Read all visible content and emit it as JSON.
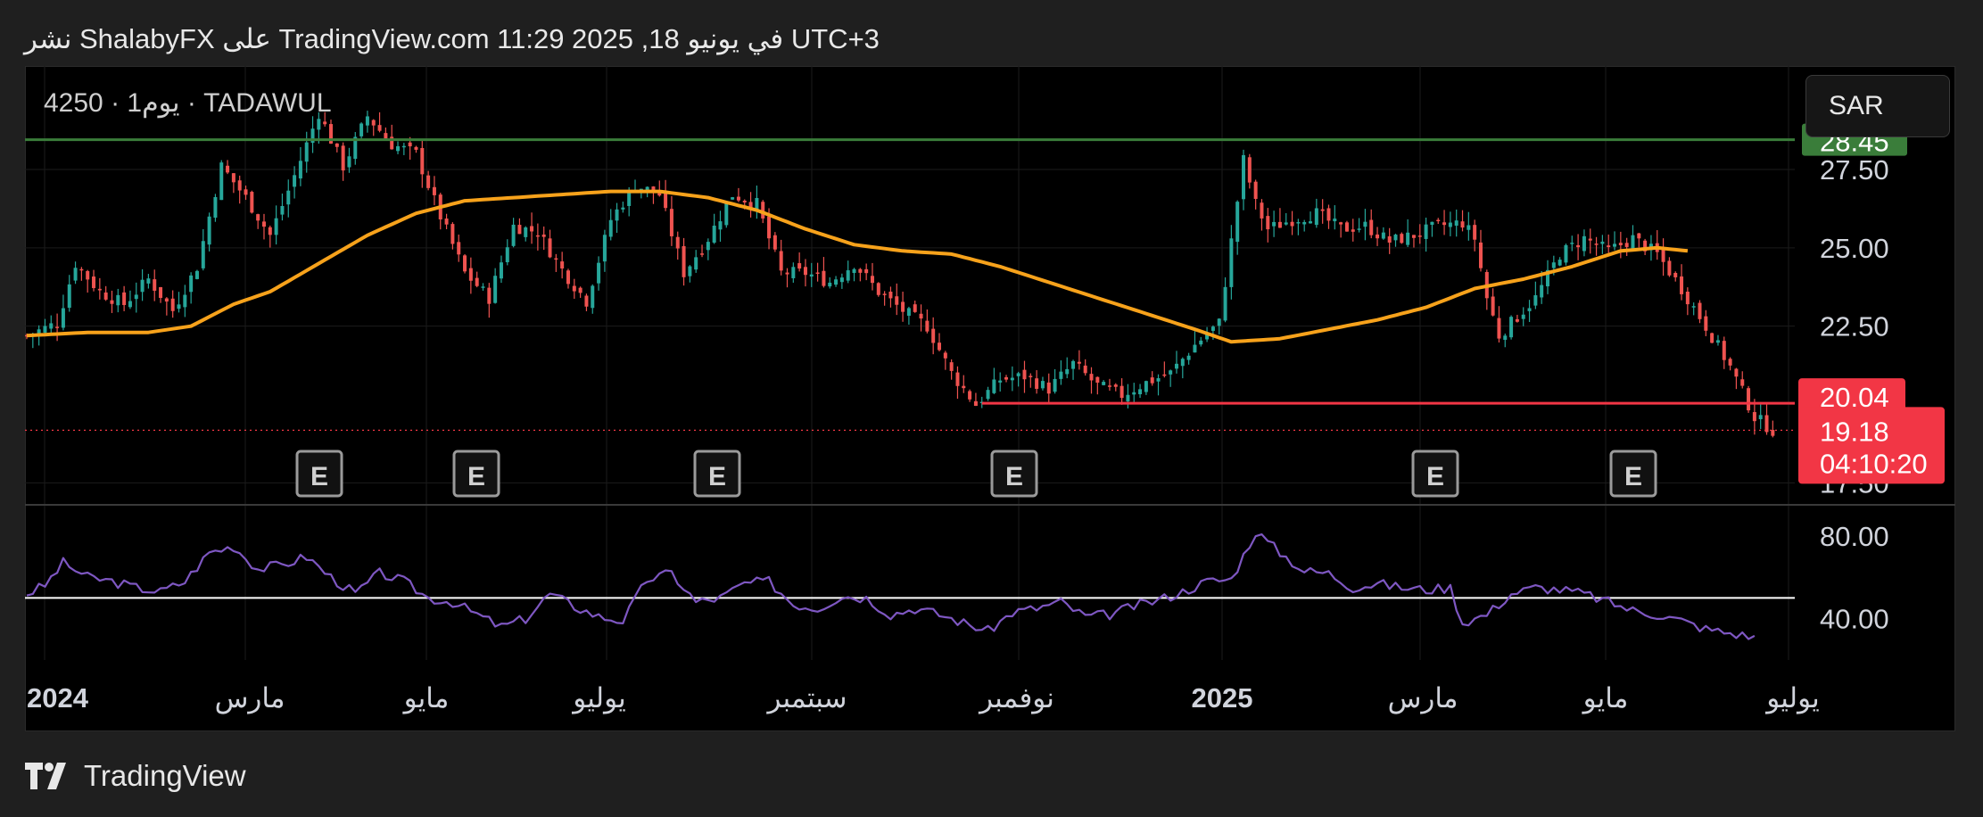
{
  "header": {
    "text": "نشر ShalabyFX على TradingView.com 11:29 2025 ,18 في يونيو UTC+3"
  },
  "symbol": {
    "label": "4250 · 1يوم · TADAWUL"
  },
  "currency": {
    "label": "SAR"
  },
  "footer": {
    "brand": "TradingView"
  },
  "colors": {
    "up": "#26a69a",
    "down": "#ef5350",
    "ma": "#f7a21b",
    "rsi": "#7e57c2",
    "resistance": "#3a7d3a",
    "support": "#f23645",
    "last": "#f23645"
  },
  "chart_data": {
    "type": "candlestick",
    "price_axis": {
      "ticks": [
        {
          "label": "27.50",
          "value": 27.5
        },
        {
          "label": "25.00",
          "value": 25.0
        },
        {
          "label": "22.50",
          "value": 22.5
        },
        {
          "label": "17.50",
          "value": 17.5
        }
      ],
      "range": [
        16.8,
        30.8
      ]
    },
    "rsi_axis": {
      "ticks": [
        {
          "label": "80.00",
          "value": 80
        },
        {
          "label": "40.00",
          "value": 40
        }
      ],
      "range": [
        20,
        95
      ]
    },
    "time_axis": [
      {
        "label": "2024",
        "bold": true
      },
      {
        "label": "مارس"
      },
      {
        "label": "مايو"
      },
      {
        "label": "يوليو"
      },
      {
        "label": "سبتمبر"
      },
      {
        "label": "نوفمبر"
      },
      {
        "label": "2025",
        "bold": true
      },
      {
        "label": "مارس"
      },
      {
        "label": "مايو"
      },
      {
        "label": "يوليو"
      }
    ],
    "resistance": {
      "value": 28.45,
      "label": "28.45"
    },
    "support": {
      "value": 20.04,
      "label": "20.04"
    },
    "last_price": {
      "value": 19.18,
      "label": "19.18",
      "countdown": "04:10:20"
    },
    "earnings_marker": "E",
    "earnings_count": 6,
    "close_anchors": [
      [
        0,
        22.2
      ],
      [
        5,
        22.6
      ],
      [
        8,
        24.5
      ],
      [
        12,
        23.6
      ],
      [
        16,
        23.2
      ],
      [
        20,
        24.0
      ],
      [
        24,
        23.0
      ],
      [
        28,
        24.4
      ],
      [
        32,
        27.6
      ],
      [
        36,
        26.6
      ],
      [
        40,
        25.4
      ],
      [
        44,
        27.3
      ],
      [
        48,
        29.3
      ],
      [
        52,
        27.6
      ],
      [
        56,
        29.2
      ],
      [
        60,
        28.3
      ],
      [
        64,
        28.0
      ],
      [
        68,
        26.0
      ],
      [
        72,
        24.2
      ],
      [
        76,
        23.4
      ],
      [
        80,
        25.7
      ],
      [
        84,
        25.5
      ],
      [
        88,
        24.3
      ],
      [
        92,
        23.3
      ],
      [
        96,
        25.9
      ],
      [
        100,
        27.0
      ],
      [
        104,
        26.7
      ],
      [
        108,
        24.2
      ],
      [
        112,
        25.3
      ],
      [
        116,
        26.7
      ],
      [
        120,
        26.4
      ],
      [
        124,
        24.2
      ],
      [
        128,
        24.2
      ],
      [
        132,
        23.9
      ],
      [
        136,
        24.5
      ],
      [
        140,
        23.6
      ],
      [
        144,
        23.0
      ],
      [
        148,
        22.5
      ],
      [
        152,
        21.0
      ],
      [
        156,
        20.0
      ],
      [
        160,
        20.8
      ],
      [
        164,
        20.9
      ],
      [
        168,
        20.5
      ],
      [
        172,
        21.3
      ],
      [
        176,
        20.6
      ],
      [
        180,
        20.3
      ],
      [
        184,
        20.7
      ],
      [
        188,
        21.0
      ],
      [
        192,
        21.9
      ],
      [
        196,
        22.6
      ],
      [
        200,
        27.8
      ],
      [
        202,
        26.4
      ],
      [
        204,
        25.6
      ],
      [
        208,
        25.9
      ],
      [
        212,
        26.1
      ],
      [
        216,
        25.6
      ],
      [
        220,
        25.7
      ],
      [
        224,
        25.2
      ],
      [
        228,
        25.4
      ],
      [
        232,
        25.7
      ],
      [
        236,
        25.8
      ],
      [
        238,
        25.3
      ],
      [
        240,
        23.4
      ],
      [
        242,
        22.2
      ],
      [
        244,
        22.6
      ],
      [
        248,
        23.4
      ],
      [
        252,
        24.8
      ],
      [
        256,
        25.3
      ],
      [
        260,
        24.9
      ],
      [
        264,
        25.3
      ],
      [
        268,
        24.8
      ],
      [
        272,
        23.7
      ],
      [
        276,
        22.5
      ],
      [
        280,
        21.2
      ],
      [
        284,
        19.6
      ],
      [
        287,
        19.18
      ]
    ],
    "ma_anchors": [
      [
        0,
        22.2
      ],
      [
        10,
        22.3
      ],
      [
        20,
        22.3
      ],
      [
        27,
        22.5
      ],
      [
        34,
        23.2
      ],
      [
        40,
        23.6
      ],
      [
        48,
        24.5
      ],
      [
        56,
        25.4
      ],
      [
        64,
        26.1
      ],
      [
        72,
        26.5
      ],
      [
        80,
        26.6
      ],
      [
        88,
        26.7
      ],
      [
        96,
        26.8
      ],
      [
        104,
        26.8
      ],
      [
        112,
        26.6
      ],
      [
        120,
        26.2
      ],
      [
        128,
        25.6
      ],
      [
        136,
        25.1
      ],
      [
        144,
        24.9
      ],
      [
        152,
        24.8
      ],
      [
        160,
        24.4
      ],
      [
        168,
        23.9
      ],
      [
        176,
        23.4
      ],
      [
        184,
        22.9
      ],
      [
        192,
        22.4
      ],
      [
        198,
        22.0
      ],
      [
        206,
        22.1
      ],
      [
        214,
        22.4
      ],
      [
        222,
        22.7
      ],
      [
        230,
        23.1
      ],
      [
        238,
        23.7
      ],
      [
        246,
        24.0
      ],
      [
        254,
        24.4
      ],
      [
        262,
        24.9
      ],
      [
        268,
        25.0
      ],
      [
        273,
        24.9
      ]
    ],
    "rsi_anchors": [
      [
        0,
        52
      ],
      [
        3,
        56
      ],
      [
        6,
        67
      ],
      [
        10,
        60
      ],
      [
        14,
        58
      ],
      [
        18,
        55
      ],
      [
        22,
        53
      ],
      [
        26,
        58
      ],
      [
        30,
        72
      ],
      [
        34,
        75
      ],
      [
        38,
        64
      ],
      [
        42,
        66
      ],
      [
        46,
        70
      ],
      [
        50,
        60
      ],
      [
        54,
        52
      ],
      [
        58,
        62
      ],
      [
        62,
        58
      ],
      [
        66,
        50
      ],
      [
        70,
        48
      ],
      [
        74,
        42
      ],
      [
        78,
        36
      ],
      [
        82,
        40
      ],
      [
        86,
        52
      ],
      [
        90,
        46
      ],
      [
        94,
        41
      ],
      [
        98,
        39
      ],
      [
        102,
        59
      ],
      [
        106,
        62
      ],
      [
        110,
        48
      ],
      [
        114,
        50
      ],
      [
        118,
        57
      ],
      [
        122,
        58
      ],
      [
        126,
        47
      ],
      [
        130,
        45
      ],
      [
        134,
        51
      ],
      [
        138,
        50
      ],
      [
        142,
        42
      ],
      [
        146,
        45
      ],
      [
        150,
        42
      ],
      [
        154,
        38
      ],
      [
        158,
        34
      ],
      [
        162,
        43
      ],
      [
        166,
        45
      ],
      [
        170,
        48
      ],
      [
        174,
        41
      ],
      [
        178,
        42
      ],
      [
        182,
        46
      ],
      [
        186,
        49
      ],
      [
        190,
        53
      ],
      [
        194,
        58
      ],
      [
        198,
        59
      ],
      [
        202,
        82
      ],
      [
        206,
        72
      ],
      [
        210,
        63
      ],
      [
        214,
        62
      ],
      [
        218,
        55
      ],
      [
        222,
        57
      ],
      [
        226,
        55
      ],
      [
        230,
        54
      ],
      [
        234,
        55
      ],
      [
        236,
        38
      ],
      [
        240,
        42
      ],
      [
        244,
        52
      ],
      [
        248,
        55
      ],
      [
        252,
        54
      ],
      [
        256,
        52
      ],
      [
        260,
        48
      ],
      [
        264,
        44
      ],
      [
        268,
        42
      ],
      [
        272,
        39
      ],
      [
        276,
        35
      ],
      [
        280,
        33
      ],
      [
        284,
        31
      ]
    ]
  }
}
